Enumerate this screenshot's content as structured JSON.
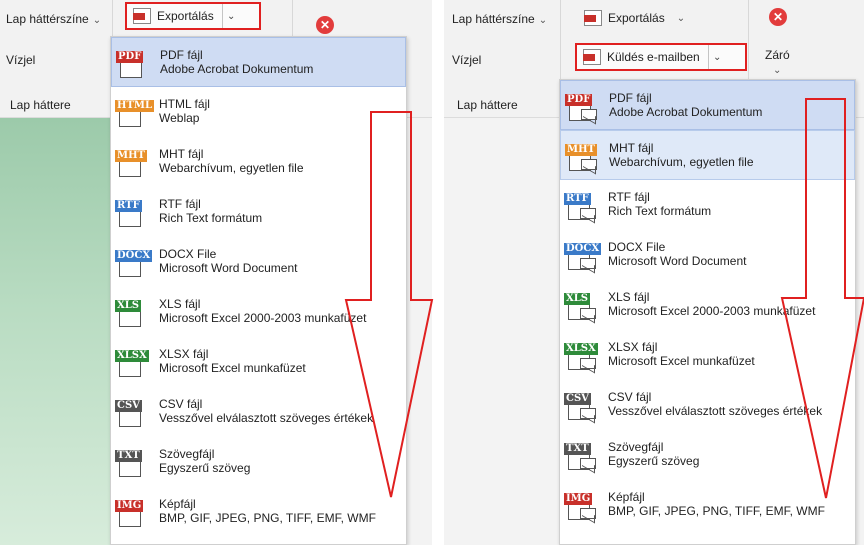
{
  "left": {
    "ribbon": {
      "background_label": "Lap háttérszíne",
      "watermark_label": "Vízjel",
      "page_background_label": "Lap háttere",
      "export_label": "Exportálás"
    },
    "menu_items": [
      {
        "tag": "PDF",
        "tag_color": "#c8302a",
        "title": "PDF fájl",
        "subtitle": "Adobe Acrobat Dokumentum",
        "highlight": "hl"
      },
      {
        "tag": "HTML",
        "tag_color": "#e8902a",
        "title": "HTML fájl",
        "subtitle": "Weblap",
        "highlight": ""
      },
      {
        "tag": "MHT",
        "tag_color": "#e8902a",
        "title": "MHT fájl",
        "subtitle": "Webarchívum, egyetlen file",
        "highlight": ""
      },
      {
        "tag": "RTF",
        "tag_color": "#3a7ac8",
        "title": "RTF fájl",
        "subtitle": "Rich Text formátum",
        "highlight": ""
      },
      {
        "tag": "DOCX",
        "tag_color": "#3a7ac8",
        "title": "DOCX File",
        "subtitle": "Microsoft Word Document",
        "highlight": ""
      },
      {
        "tag": "XLS",
        "tag_color": "#2e8b3a",
        "title": "XLS fájl",
        "subtitle": "Microsoft Excel 2000-2003 munkafüzet",
        "highlight": ""
      },
      {
        "tag": "XLSX",
        "tag_color": "#2e8b3a",
        "title": "XLSX fájl",
        "subtitle": "Microsoft Excel munkafüzet",
        "highlight": ""
      },
      {
        "tag": "CSV",
        "tag_color": "#555555",
        "title": "CSV fájl",
        "subtitle": "Vesszővel elválasztott szöveges értékek",
        "highlight": ""
      },
      {
        "tag": "TXT",
        "tag_color": "#555555",
        "title": "Szövegfájl",
        "subtitle": "Egyszerű szöveg",
        "highlight": ""
      },
      {
        "tag": "IMG",
        "tag_color": "#c8302a",
        "title": "Képfájl",
        "subtitle": "BMP, GIF, JPEG, PNG, TIFF, EMF, WMF",
        "highlight": ""
      }
    ]
  },
  "right": {
    "ribbon": {
      "background_label": "Lap háttérszíne",
      "watermark_label": "Vízjel",
      "page_background_label": "Lap háttere",
      "export_label": "Exportálás",
      "email_label": "Küldés e-mailben",
      "close_label": "Záró"
    },
    "menu_items": [
      {
        "tag": "PDF",
        "tag_color": "#c8302a",
        "title": "PDF fájl",
        "subtitle": "Adobe Acrobat Dokumentum",
        "highlight": "hl"
      },
      {
        "tag": "MHT",
        "tag_color": "#e8902a",
        "title": "MHT fájl",
        "subtitle": "Webarchívum, egyetlen file",
        "highlight": "hl2"
      },
      {
        "tag": "RTF",
        "tag_color": "#3a7ac8",
        "title": "RTF fájl",
        "subtitle": "Rich Text formátum",
        "highlight": ""
      },
      {
        "tag": "DOCX",
        "tag_color": "#3a7ac8",
        "title": "DOCX File",
        "subtitle": "Microsoft Word Document",
        "highlight": ""
      },
      {
        "tag": "XLS",
        "tag_color": "#2e8b3a",
        "title": "XLS fájl",
        "subtitle": "Microsoft Excel 2000-2003 munkafüzet",
        "highlight": ""
      },
      {
        "tag": "XLSX",
        "tag_color": "#2e8b3a",
        "title": "XLSX fájl",
        "subtitle": "Microsoft Excel munkafüzet",
        "highlight": ""
      },
      {
        "tag": "CSV",
        "tag_color": "#555555",
        "title": "CSV fájl",
        "subtitle": "Vesszővel elválasztott szöveges értékek",
        "highlight": ""
      },
      {
        "tag": "TXT",
        "tag_color": "#555555",
        "title": "Szövegfájl",
        "subtitle": "Egyszerű szöveg",
        "highlight": ""
      },
      {
        "tag": "IMG",
        "tag_color": "#c8302a",
        "title": "Képfájl",
        "subtitle": "BMP, GIF, JPEG, PNG, TIFF, EMF, WMF",
        "highlight": ""
      }
    ]
  },
  "icons": {
    "chevron": "chevron-down-icon",
    "close": "close-circle-icon",
    "export": "export-document-icon",
    "email": "email-document-icon"
  },
  "colors": {
    "highlight_box": "#e02020",
    "annotation_arrow": "#e02020",
    "selected_item": "#cfdcf3",
    "page_background_green": "#b9dcc2"
  }
}
